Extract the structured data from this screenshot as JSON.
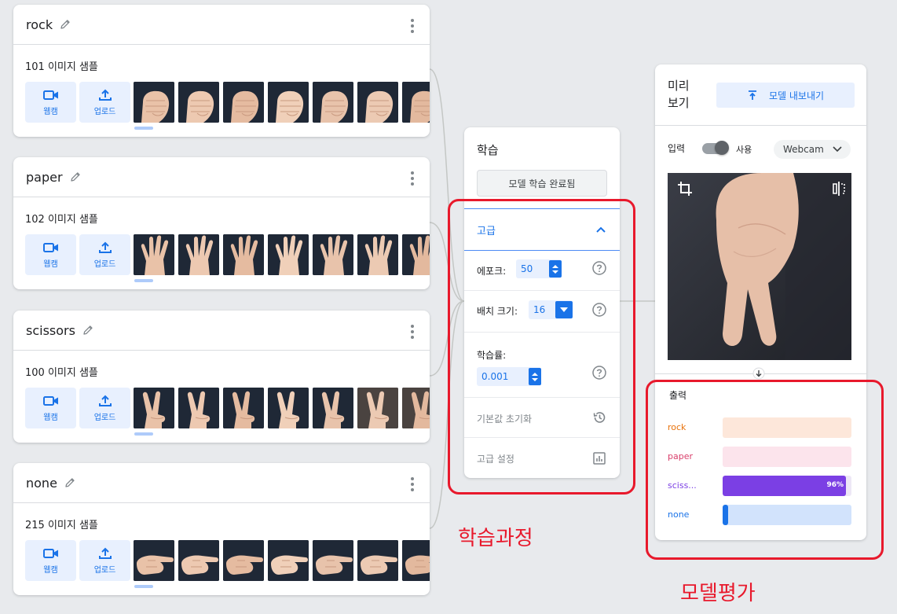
{
  "classes": [
    {
      "name": "rock",
      "count_label": "101 이미지 샘플",
      "thumb_kind": "rock"
    },
    {
      "name": "paper",
      "count_label": "102 이미지 샘플",
      "thumb_kind": "paper"
    },
    {
      "name": "scissors",
      "count_label": "100 이미지 샘플",
      "thumb_kind": "scissors"
    },
    {
      "name": "none",
      "count_label": "215 이미지 샘플",
      "thumb_kind": "none"
    }
  ],
  "class_tools": {
    "webcam_label": "웹캠",
    "upload_label": "업로드"
  },
  "training": {
    "title": "학습",
    "train_button": "모델 학습 완료됨",
    "advanced_label": "고급",
    "epochs_label": "에포크:",
    "epochs_value": "50",
    "batch_label": "배치 크기:",
    "batch_value": "16",
    "lr_label": "학습률:",
    "lr_value": "0.001",
    "reset_label": "기본값 초기화",
    "advanced_settings_label": "고급 설정"
  },
  "preview": {
    "title": "미리 보기",
    "export_button": "모델 내보내기",
    "input_label": "입력",
    "toggle_label": "사용",
    "toggle_on": true,
    "source_select": "Webcam",
    "output_label": "출력",
    "outputs": [
      {
        "name": "rock",
        "value": 0.0,
        "pct_label": "",
        "color": "#e8710a",
        "bg": "#fde7da"
      },
      {
        "name": "paper",
        "value": 0.0,
        "pct_label": "",
        "color": "#d93f6b",
        "bg": "#fce4ec"
      },
      {
        "name": "sciss...",
        "value": 0.96,
        "pct_label": "96%",
        "color": "#7b3fe4",
        "bg": "#ede7f6"
      },
      {
        "name": "none",
        "value": 0.04,
        "pct_label": "",
        "color": "#1a73e8",
        "bg": "#d2e3fc"
      }
    ]
  },
  "annotations": {
    "training_label": "학습과정",
    "evaluation_label": "모델평가",
    "color": "#e8192c"
  }
}
